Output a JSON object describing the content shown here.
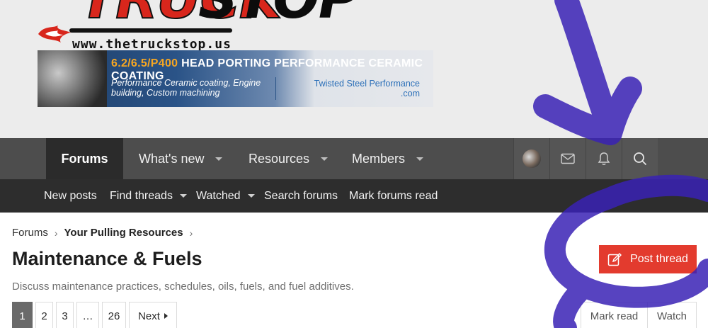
{
  "site": {
    "logo_text_left": "TRUCK",
    "logo_text_right": "STOP",
    "url": "www.thetruckstop.us"
  },
  "banner": {
    "headline_accent": "6.2/6.5/P400",
    "headline_rest": "HEAD PORTING PERFORMANCE CERAMIC COATING",
    "subtext": "Performance Ceramic coating, Engine building, Custom machining",
    "brand_line1": "Twisted Steel Performance",
    "brand_line2": ".com"
  },
  "nav": {
    "tabs": [
      {
        "label": "Forums",
        "active": true
      },
      {
        "label": "What's new",
        "dropdown": true
      },
      {
        "label": "Resources",
        "dropdown": true
      },
      {
        "label": "Members",
        "dropdown": true
      }
    ],
    "icons": [
      "avatar",
      "mail-icon",
      "bell-icon",
      "search-icon"
    ]
  },
  "subnav": {
    "items": [
      {
        "label": "New posts"
      },
      {
        "label": "Find threads",
        "dropdown": true
      },
      {
        "label": "Watched",
        "dropdown": true
      },
      {
        "label": "Search forums"
      },
      {
        "label": "Mark forums read"
      }
    ]
  },
  "breadcrumb": {
    "items": [
      "Forums",
      "Your Pulling Resources"
    ]
  },
  "page": {
    "title": "Maintenance & Fuels",
    "description": "Discuss maintenance practices, schedules, oils, fuels, and fuel additives."
  },
  "actions": {
    "post_thread": "Post thread",
    "mark_read": "Mark read",
    "watch": "Watch"
  },
  "pagination": {
    "pages": [
      "1",
      "2",
      "3"
    ],
    "gap": "…",
    "last": "26",
    "next": "Next",
    "current": 1,
    "total": 26
  },
  "colors": {
    "nav_bg": "#4d4d4d",
    "subnav_bg": "#2d2d2d",
    "accent_button": "#e33b2e",
    "scribble": "#3a22b5"
  }
}
